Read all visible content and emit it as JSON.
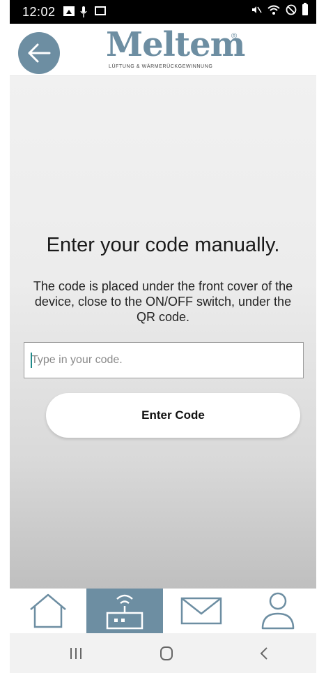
{
  "status_bar": {
    "time": "12:02"
  },
  "header": {
    "logo_text": "Meltem",
    "logo_registered": "®",
    "logo_tagline": "LÜFTUNG & WÄRMERÜCKGEWINNUNG"
  },
  "main": {
    "title": "Enter your code manually.",
    "description": "The code is placed under the front cover of the device, close to the ON/OFF switch, under the QR code.",
    "input": {
      "placeholder": "Type in your code.",
      "value": ""
    },
    "button_label": "Enter Code"
  },
  "bottom_nav": {
    "items": [
      {
        "icon": "home-icon",
        "active": false
      },
      {
        "icon": "router-icon",
        "active": true
      },
      {
        "icon": "mail-icon",
        "active": false
      },
      {
        "icon": "user-icon",
        "active": false
      }
    ]
  },
  "colors": {
    "accent": "#6d8ea2",
    "status_bar": "#000000"
  }
}
